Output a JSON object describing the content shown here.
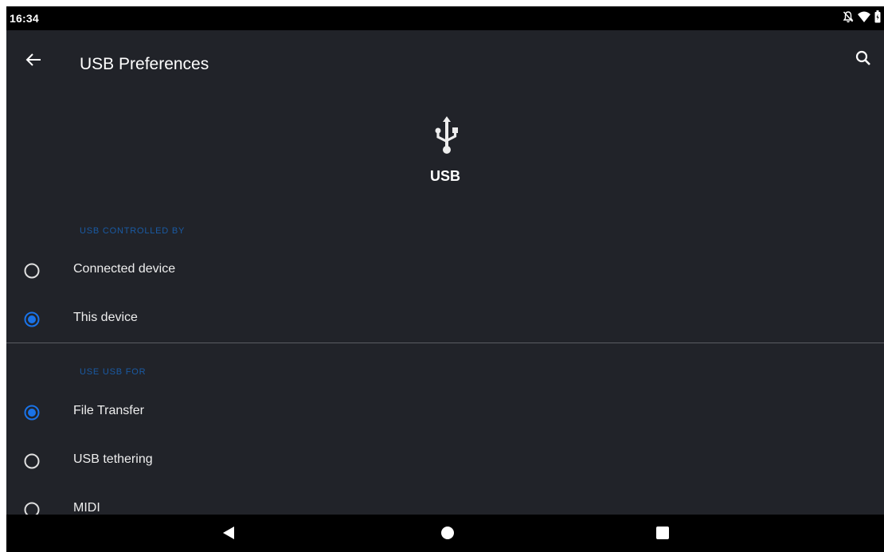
{
  "status_bar": {
    "time": "16:34",
    "icons": [
      "notifications-off-icon",
      "wifi-icon",
      "battery-icon"
    ]
  },
  "app_bar": {
    "title": "USB Preferences",
    "back_icon": "arrow-back-icon",
    "search_icon": "search-icon"
  },
  "header": {
    "icon": "usb-icon",
    "label": "USB"
  },
  "sections": [
    {
      "title": "USB CONTROLLED BY",
      "options": [
        {
          "label": "Connected device",
          "selected": false
        },
        {
          "label": "This device",
          "selected": true
        }
      ]
    },
    {
      "title": "USE USB FOR",
      "options": [
        {
          "label": "File Transfer",
          "selected": true
        },
        {
          "label": "USB tethering",
          "selected": false
        },
        {
          "label": "MIDI",
          "selected": false
        }
      ]
    }
  ],
  "nav_bar": {
    "buttons": [
      "back-triangle-icon",
      "home-circle-icon",
      "recents-square-icon"
    ]
  },
  "colors": {
    "background": "#212329",
    "accent": "#1a73e8",
    "section_header": "#1a5aa3",
    "text": "#eeeeee"
  }
}
